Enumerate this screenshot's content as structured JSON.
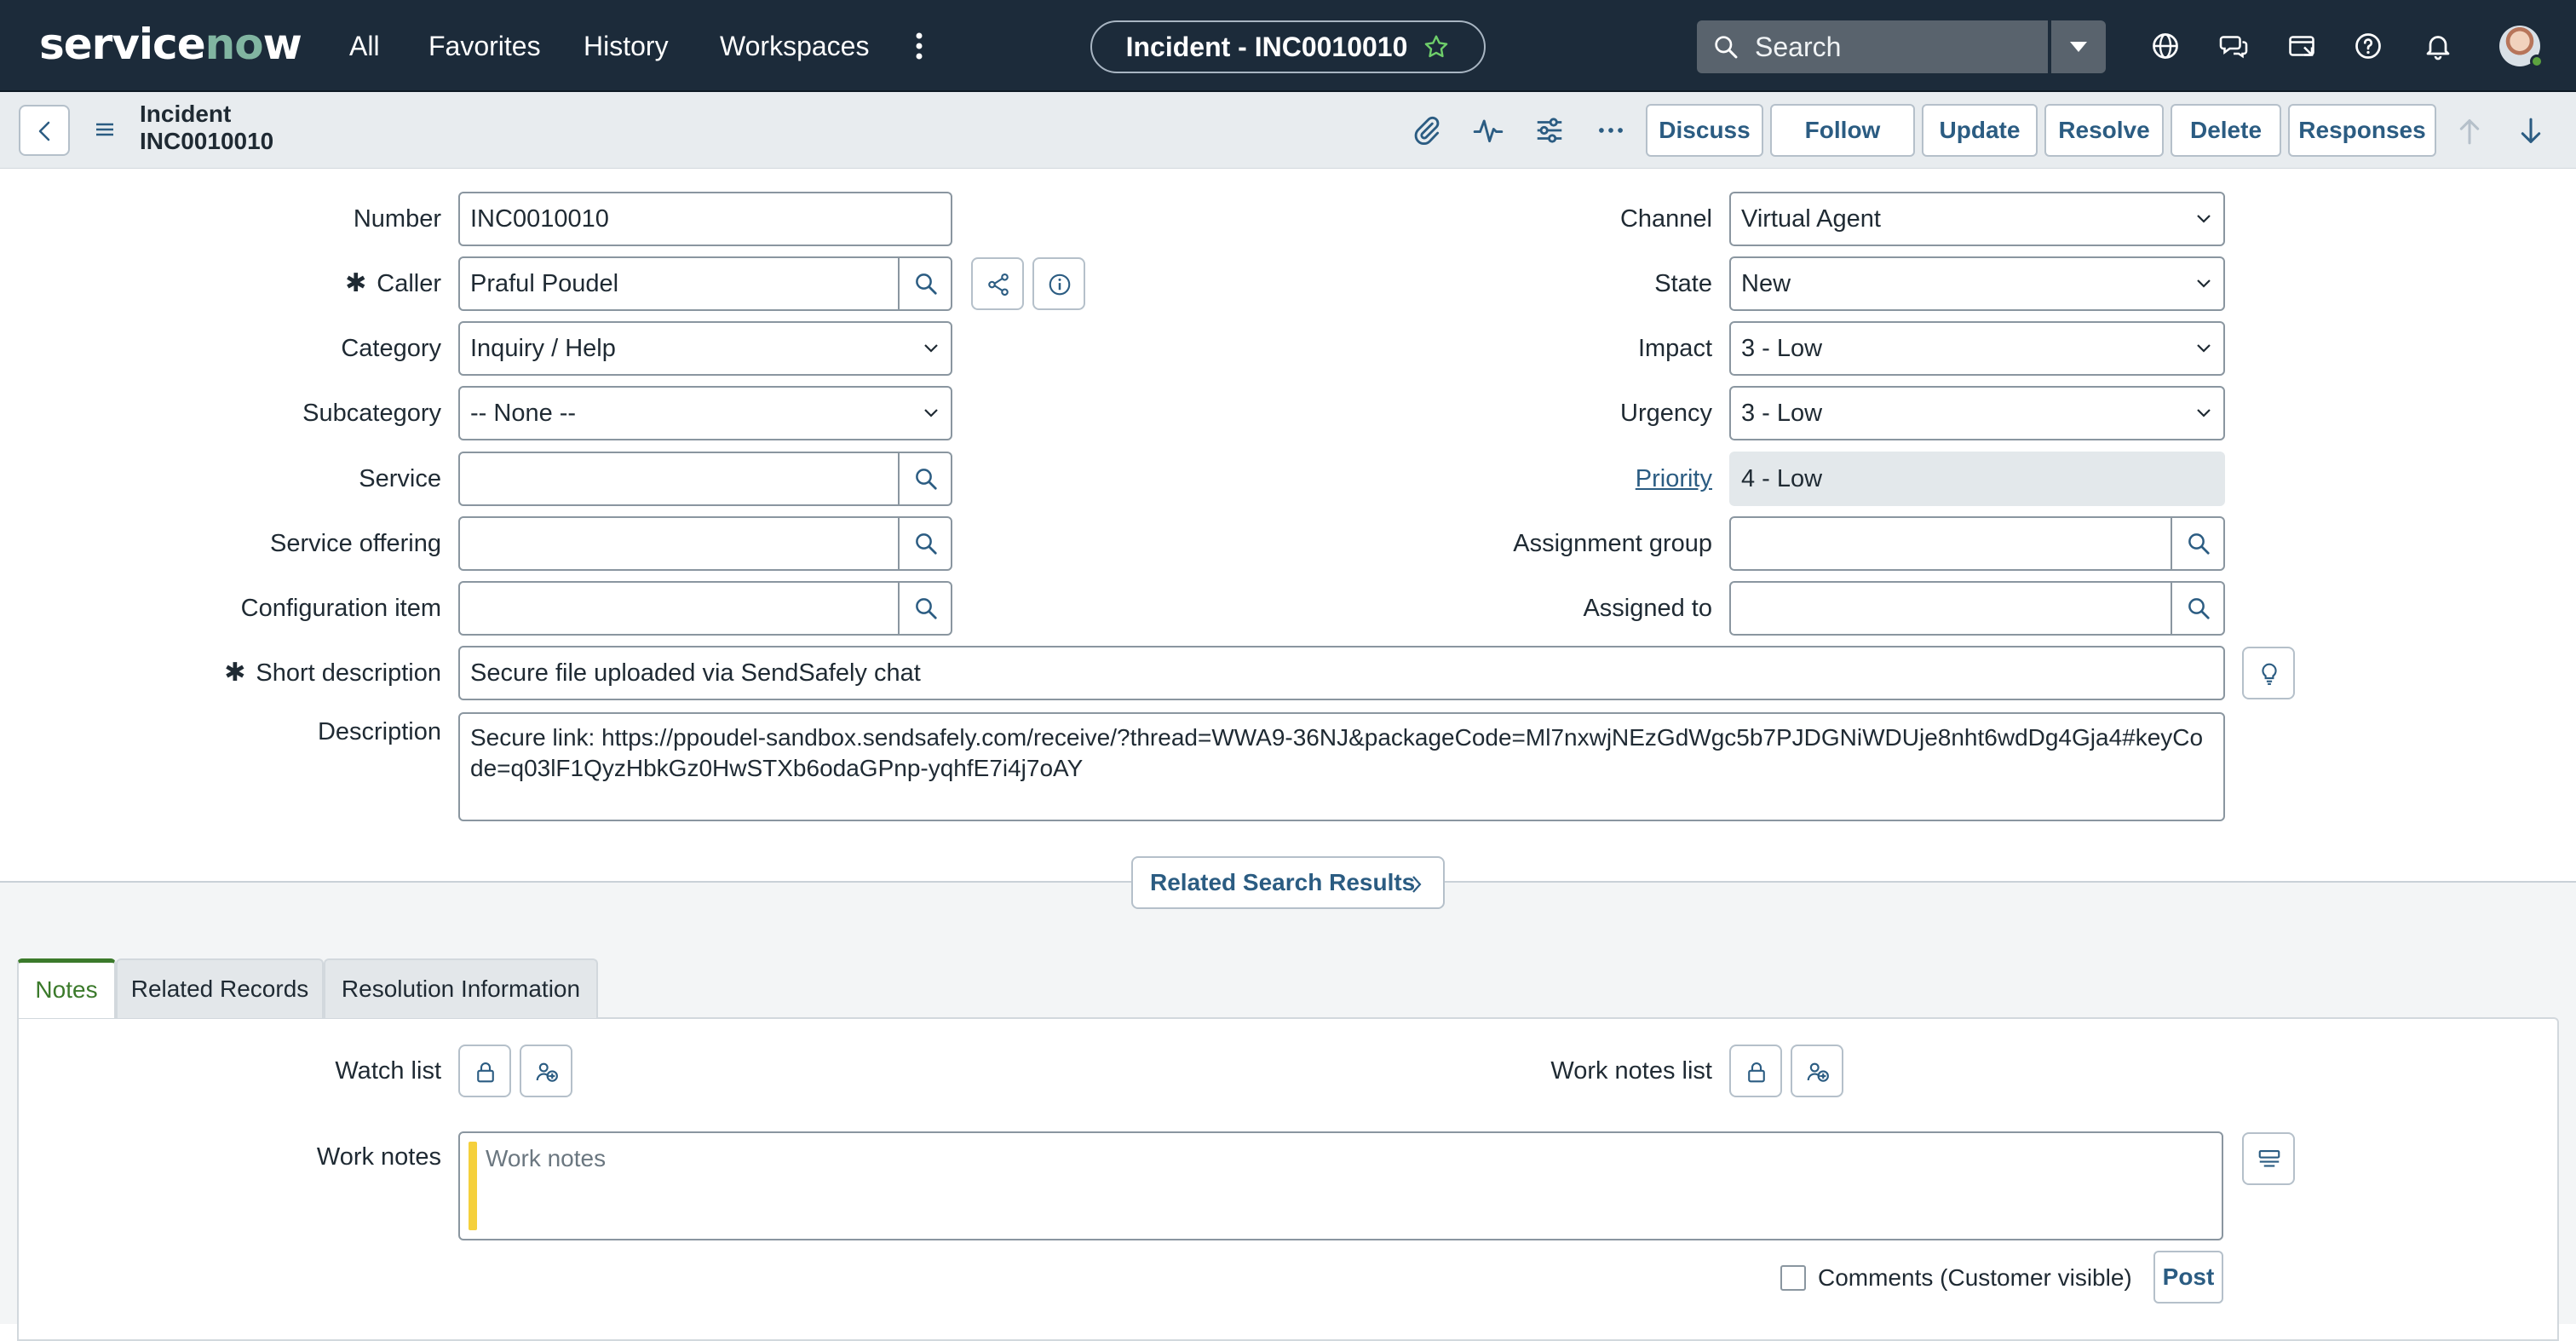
{
  "nav": {
    "logo": "servicenow",
    "links": [
      "All",
      "Favorites",
      "History",
      "Workspaces"
    ],
    "title": "Incident - INC0010010",
    "search_placeholder": "Search",
    "icons": [
      "globe-icon",
      "chat-icon",
      "inbox-icon",
      "help-icon",
      "bell-icon"
    ]
  },
  "header": {
    "line1": "Incident",
    "line2": "INC0010010",
    "buttons": [
      "Discuss",
      "Follow",
      "Update",
      "Resolve",
      "Delete",
      "Responses"
    ]
  },
  "form": {
    "number": {
      "label": "Number",
      "value": "INC0010010"
    },
    "caller": {
      "label": "Caller",
      "value": "Praful Poudel",
      "mandatory": "✱"
    },
    "category": {
      "label": "Category",
      "value": "Inquiry / Help"
    },
    "subcategory": {
      "label": "Subcategory",
      "value": "-- None --"
    },
    "service": {
      "label": "Service",
      "value": ""
    },
    "service_offering": {
      "label": "Service offering",
      "value": ""
    },
    "configuration_item": {
      "label": "Configuration item",
      "value": ""
    },
    "channel": {
      "label": "Channel",
      "value": "Virtual Agent"
    },
    "state": {
      "label": "State",
      "value": "New"
    },
    "impact": {
      "label": "Impact",
      "value": "3 - Low"
    },
    "urgency": {
      "label": "Urgency",
      "value": "3 - Low"
    },
    "priority": {
      "label": "Priority",
      "value": "4 - Low"
    },
    "assignment_group": {
      "label": "Assignment group",
      "value": ""
    },
    "assigned_to": {
      "label": "Assigned to",
      "value": ""
    },
    "short_description": {
      "label": "Short description",
      "value": "Secure file uploaded via SendSafely chat",
      "mandatory": "✱"
    },
    "description": {
      "label": "Description",
      "value": "Secure link: https://ppoudel-sandbox.sendsafely.com/receive/?thread=WWA9-36NJ&packageCode=Ml7nxwjNEzGdWgc5b7PJDGNiWDUje8nht6wdDg4Gja4#keyCode=q03lF1QyzHbkGz0HwSTXb6odaGPnp-yqhfE7i4j7oAY"
    }
  },
  "related_search": "Related Search Results",
  "tabs": [
    "Notes",
    "Related Records",
    "Resolution Information"
  ],
  "notes": {
    "watch_list": "Watch list",
    "work_notes_list": "Work notes list",
    "work_notes_label": "Work notes",
    "work_notes_placeholder": "Work notes",
    "comments_label": "Comments (Customer visible)",
    "post": "Post"
  },
  "colors": {
    "nav_bg": "#1c2b3a",
    "accent": "#2b5c82",
    "active_tab": "#3b7a2b",
    "work_notes_bar": "#f5d03c"
  }
}
